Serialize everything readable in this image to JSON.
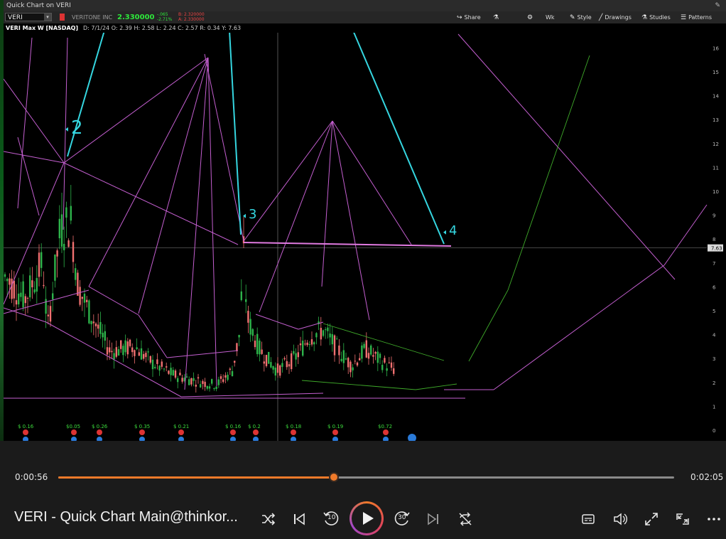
{
  "window": {
    "title": "Quick Chart on VERI"
  },
  "toolbar": {
    "symbol": "VERI",
    "company": "VERITONE INC",
    "price": "2.330000",
    "change_abs": "-.065",
    "change_pct": "-2.71%",
    "bid": "B: 2.320000",
    "ask": "A: 2.330000",
    "share_label": "Share",
    "period_label": "Wk",
    "style_label": "Style",
    "drawings_label": "Drawings",
    "studies_label": "Studies",
    "patterns_label": "Patterns"
  },
  "info": {
    "name": "VERI Max W [NASDAQ]",
    "values": "D: 7/1/24   O: 2.39   H: 2.58   L: 2.24   C: 2.57   R: 0.34   Y: 7.63"
  },
  "chart": {
    "price_axis": [
      "16",
      "15",
      "14",
      "13",
      "12",
      "11",
      "10",
      "9",
      "8",
      "7",
      "6",
      "5",
      "4",
      "3",
      "2",
      "1",
      "0"
    ],
    "price_label": "7.63",
    "annotations": [
      "2",
      "3",
      "4"
    ],
    "earnings": [
      "$ 0.16",
      "$0.05",
      "$ 0.26",
      "$ 0.35",
      "$ 0.21",
      "$ 0.16",
      "$ 0.2",
      "$ 0.18",
      "$ 0.19",
      "$0.72"
    ],
    "colors": {
      "up": "#2db34a",
      "down": "#f07070",
      "trend": "#c45fd0",
      "cyan": "#35d6e0",
      "green_line": "#3faa2a"
    }
  },
  "player": {
    "current_time": "0:00:56",
    "total_time": "0:02:05",
    "progress_fraction": 0.448,
    "title": "VERI - Quick Chart Main@thinkor...",
    "skip_back_label": "10",
    "skip_fwd_label": "30"
  }
}
